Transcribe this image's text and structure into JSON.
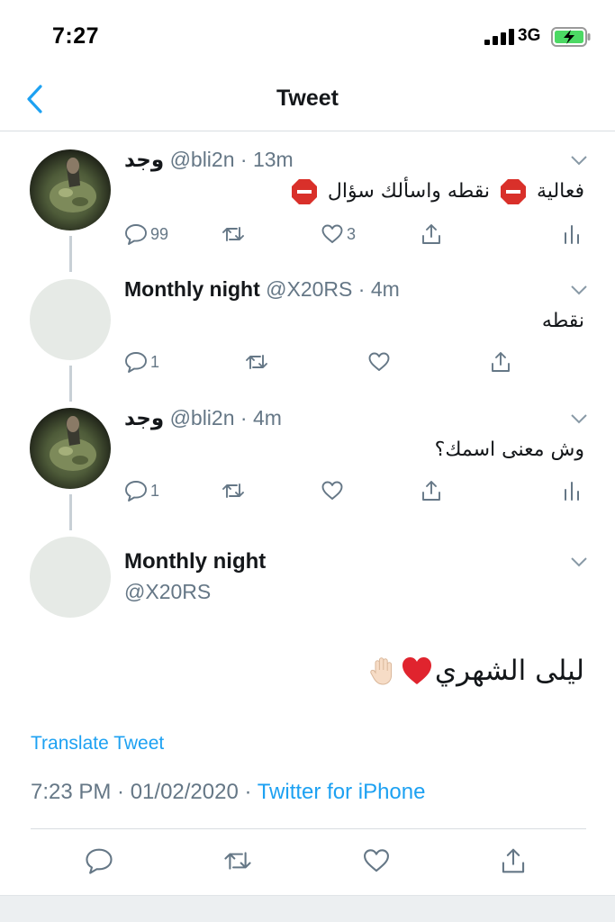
{
  "status_bar": {
    "time": "7:27",
    "network": "3G"
  },
  "nav": {
    "title": "Tweet"
  },
  "thread": [
    {
      "name": "وجد",
      "handle": "@bli2n",
      "time": "13m",
      "text_part1": "فعالية",
      "text_part2": "نقطه واسألك سؤال",
      "reply_count": "99",
      "like_count": "3"
    },
    {
      "name": "Monthly night",
      "handle": "@X20RS",
      "time": "4m",
      "text": "نقطه",
      "reply_count": "1"
    },
    {
      "name": "وجد",
      "handle": "@bli2n",
      "time": "4m",
      "text": "وش معنى اسمك؟",
      "reply_count": "1"
    }
  ],
  "main_tweet": {
    "name": "Monthly night",
    "handle": "@X20RS",
    "text": "ليلى الشهري",
    "translate_label": "Translate Tweet",
    "time": "7:23 PM · 01/02/2020 · ",
    "source": "Twitter for iPhone"
  },
  "icons": {
    "reply": "reply-icon",
    "retweet": "retweet-icon",
    "like": "heart-icon",
    "share": "share-icon",
    "analytics": "analytics-icon",
    "emoji_stop": "stop-sign-emoji",
    "emoji_heart": "red-heart-emoji",
    "emoji_hand": "raised-hand-emoji"
  },
  "colors": {
    "accent": "#1da1f2",
    "muted": "#657786",
    "stop": "#d9302a",
    "heart": "#e0242e"
  }
}
